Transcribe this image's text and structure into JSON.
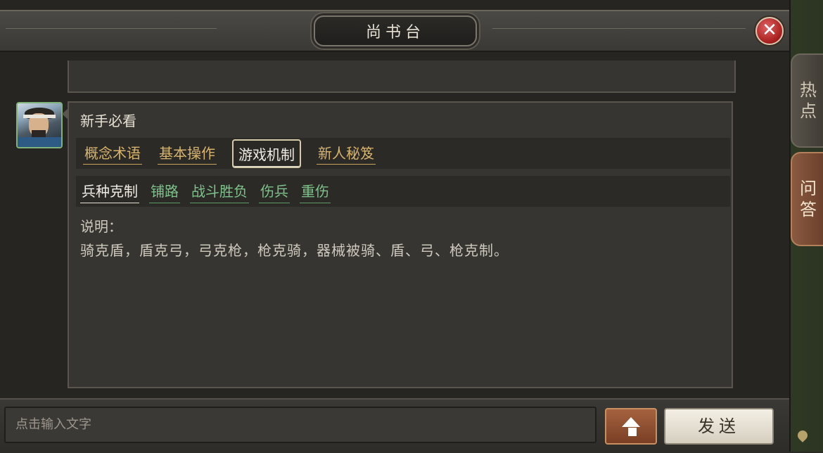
{
  "window": {
    "title": "尚书台",
    "close_symbol": "✕"
  },
  "side_tabs": [
    {
      "label_line1": "热",
      "label_line2": "点"
    },
    {
      "label_line1": "问",
      "label_line2": "答"
    }
  ],
  "message": {
    "title": "新手必看",
    "categories": [
      "概念术语",
      "基本操作",
      "游戏机制",
      "新人秘笈"
    ],
    "active_category": "游戏机制",
    "subtopics": [
      "兵种克制",
      "铺路",
      "战斗胜负",
      "伤兵",
      "重伤"
    ],
    "active_subtopic": "兵种克制",
    "desc_label": "说明：",
    "desc_text": "骑克盾，盾克弓，弓克枪，枪克骑，器械被骑、盾、弓、枪克制。"
  },
  "composer": {
    "placeholder": "点击输入文字",
    "send_label": "发送"
  },
  "colors": {
    "category": "#d9b46c",
    "subtopic": "#7dc38a",
    "close": "#a51d1d",
    "qa_tab": "#8a5a40"
  }
}
